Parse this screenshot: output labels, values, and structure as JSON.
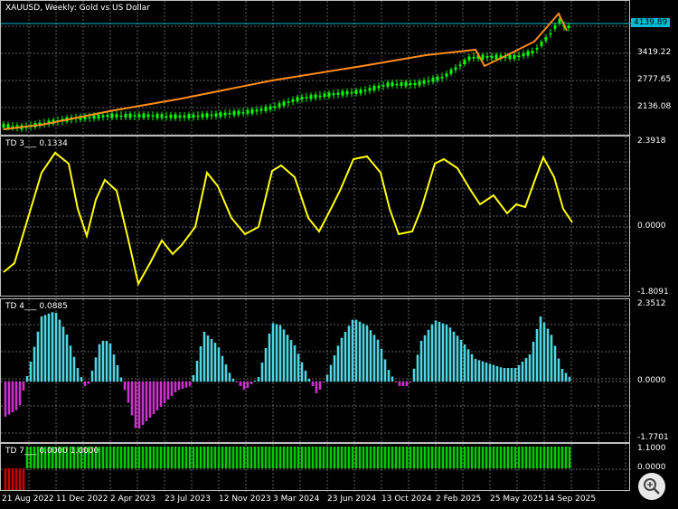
{
  "main": {
    "title": "XAUUSD, Weekly:  Gold vs US Dollar",
    "current_price": "4139.89",
    "price_ticks": [
      "3419.22",
      "2777.65",
      "2136.08"
    ],
    "colors": {
      "candles": "#00ff00",
      "overlay_line": "#ff8c1a",
      "price_line": "#00bcd4"
    }
  },
  "td3": {
    "title": "TD 3___ 0.1334",
    "ticks": [
      "2.3918",
      "0.0000",
      "-1.8091"
    ],
    "color": "#ffff00"
  },
  "td4": {
    "title": "TD 4___ 0.0885",
    "ticks": [
      "2.3512",
      "0.0000",
      "-1.7701"
    ],
    "colors": {
      "positive": "#4fd6e0",
      "negative": "#cc33cc"
    }
  },
  "td7": {
    "title": "TD 7___ 0.0000 1.0000",
    "ticks": [
      "1.1000",
      "0.0000"
    ],
    "colors": {
      "up": "#00cc00",
      "down": "#cc0000"
    }
  },
  "time_axis": [
    "21 Aug 2022",
    "11 Dec 2022",
    "2 Apr 2023",
    "23 Jul 2023",
    "12 Nov 2023",
    "3 Mar 2024",
    "23 Jun 2024",
    "13 Oct 2024",
    "2 Feb 2025",
    "25 May 2025",
    "14 Sep 2025"
  ],
  "zoom_icon": "magnifier-zoom-icon"
}
